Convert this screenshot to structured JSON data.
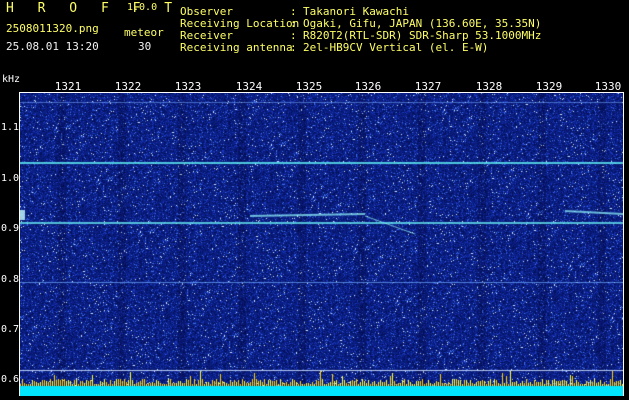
{
  "app": {
    "name": "H R O F F T",
    "version": "1.0.0"
  },
  "file": {
    "name": "2508011320.png",
    "datetime": "25.08.01 13:20"
  },
  "meteor": {
    "label": "meteor",
    "count": "30"
  },
  "info": [
    {
      "key": "Observer",
      "sep": ":",
      "value": "Takanori Kawachi"
    },
    {
      "key": "Receiving Location",
      "sep": ":",
      "value": "Ogaki, Gifu, JAPAN (136.60E, 35.35N)"
    },
    {
      "key": "Receiver",
      "sep": ":",
      "value": "R820T2(RTL-SDR) SDR-Sharp 53.1000MHz"
    },
    {
      "key": "Receiving antenna",
      "sep": ":",
      "value": "2el-HB9CV Vertical (el. E-W)"
    }
  ],
  "axis": {
    "y_unit": "kHz",
    "x_ticks": [
      "1321",
      "1322",
      "1323",
      "1324",
      "1325",
      "1326",
      "1327",
      "1328",
      "1329",
      "1330"
    ],
    "y_ticks": [
      "1.1",
      "1.0",
      "0.9",
      "0.8",
      "0.7",
      "0.6"
    ]
  },
  "colors": {
    "header_yellow": "#ffff66",
    "header_white": "#f2f2f2",
    "background": "#0b1f85",
    "signal": "#7fffff"
  }
}
